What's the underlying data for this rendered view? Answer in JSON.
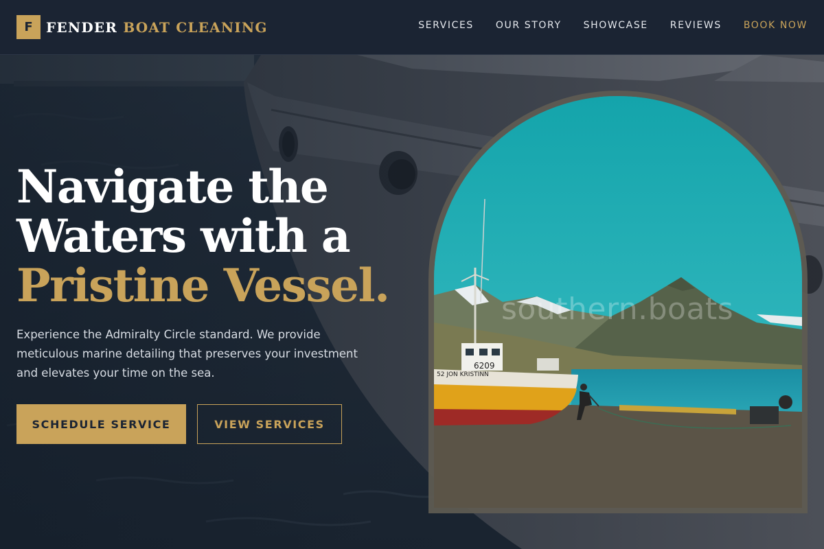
{
  "brand": {
    "mark": "F",
    "name_part1": "FENDER",
    "name_part2": "BOAT CLEANING"
  },
  "nav": {
    "items": [
      "SERVICES",
      "OUR STORY",
      "SHOWCASE",
      "REVIEWS"
    ],
    "cta": "BOOK NOW"
  },
  "hero": {
    "title_line1": "Navigate the",
    "title_line2": "Waters with a",
    "title_highlight": "Pristine Vessel.",
    "subtitle": "Experience the Admiralty Circle standard. We provide meticulous marine detailing that preserves your investment and elevates your time on the sea.",
    "primary_button": "SCHEDULE SERVICE",
    "secondary_button": "VIEW SERVICES"
  },
  "image": {
    "boat_number": "6209",
    "boat_name": "52  JON KRISTINN",
    "watermark": "southern.boats"
  },
  "colors": {
    "accent": "#c9a35a",
    "header_bg": "#1b2433",
    "text": "#ffffff"
  }
}
